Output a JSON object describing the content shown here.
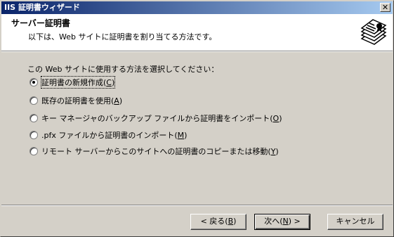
{
  "window": {
    "title": "IIS 証明書ウィザード",
    "close_glyph": "✕"
  },
  "header": {
    "title": "サーバー証明書",
    "subtitle": "以下は、Web サイトに証明書を割り当てる方法です。",
    "icon": "certificate-stack-icon"
  },
  "main": {
    "prompt": "この Web サイトに使用する方法を選択してください：",
    "options": [
      {
        "label": "証明書の新規作成",
        "hotkey": "C",
        "selected": true
      },
      {
        "label": "既存の証明書を使用",
        "hotkey": "A",
        "selected": false
      },
      {
        "label": "キー マネージャのバックアップ ファイルから証明書をインポート",
        "hotkey": "O",
        "selected": false
      },
      {
        "label": ".pfx ファイルから証明書のインポート",
        "hotkey": "M",
        "selected": false
      },
      {
        "label": "リモート サーバーからこのサイトへの証明書のコピーまたは移動",
        "hotkey": "Y",
        "selected": false
      }
    ]
  },
  "buttons": {
    "back": {
      "label": "< 戻る",
      "hotkey": "B"
    },
    "next": {
      "label": "次へ",
      "hotkey": "N",
      "suffix": " >"
    },
    "cancel": {
      "label": "キャンセル"
    }
  },
  "colors": {
    "titlebar_start": "#0a246a",
    "titlebar_end": "#a6caf0",
    "face": "#d4d0c8"
  }
}
